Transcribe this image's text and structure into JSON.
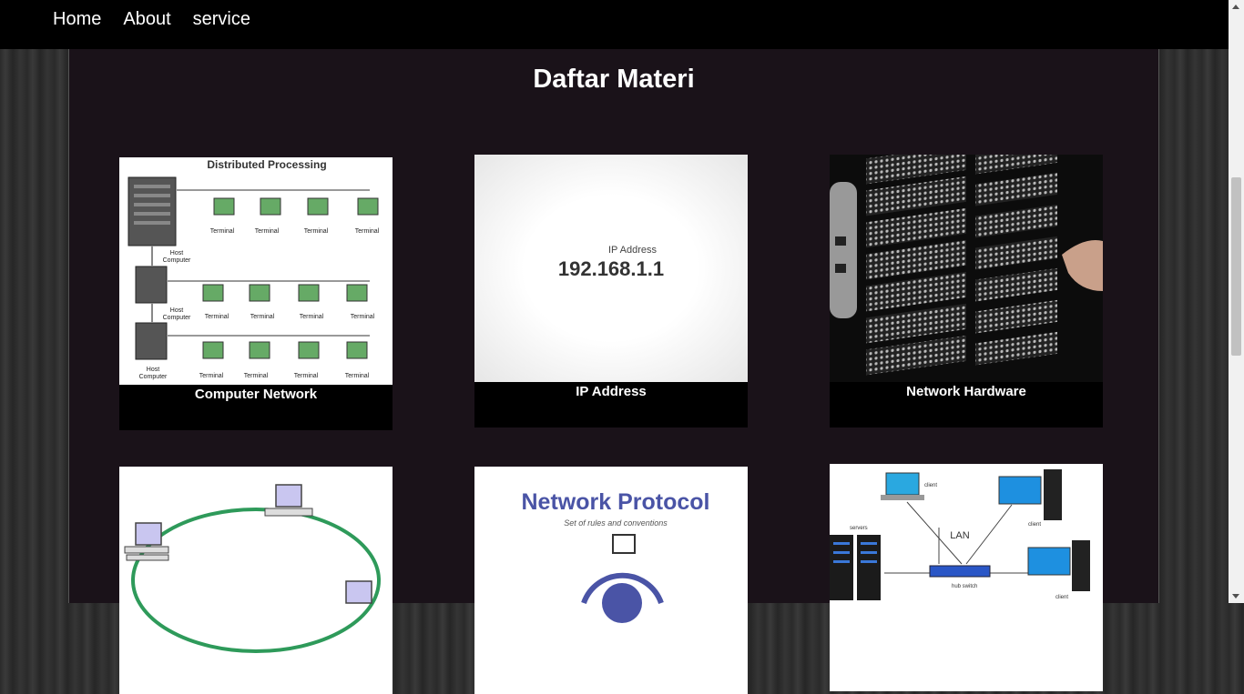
{
  "nav": {
    "items": [
      "Home",
      "About",
      "service"
    ]
  },
  "page_title": "Daftar Materi",
  "cards": [
    {
      "label": "Computer Network",
      "image": {
        "title": "Distributed Processing",
        "terminal": "Terminal",
        "host": [
          "Host",
          "Computer"
        ]
      }
    },
    {
      "label": "IP Address",
      "image": {
        "caption": "IP Address",
        "ip": "192.168.1.1"
      }
    },
    {
      "label": "Network Hardware",
      "image": {}
    },
    {
      "label": "",
      "image": {}
    },
    {
      "label": "",
      "image": {
        "title": "Network Protocol",
        "subtitle": "Set of rules and conventions"
      }
    },
    {
      "label": "",
      "image": {
        "lan": "LAN",
        "client": "client",
        "servers": "servers",
        "hub": "hub switch"
      }
    }
  ],
  "colors": {
    "nav_bg": "#000000",
    "panel_bg": "#1a1219",
    "text": "#ffffff"
  }
}
